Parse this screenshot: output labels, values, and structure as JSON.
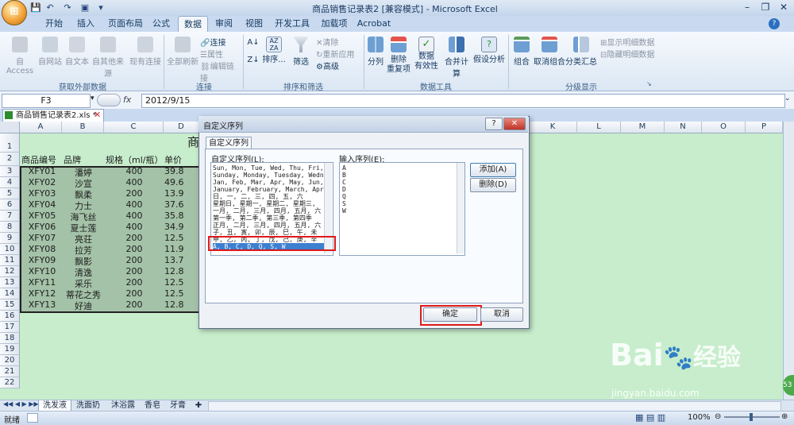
{
  "app": {
    "title": "商品销售记录表2 [兼容模式] - Microsoft Excel",
    "window_buttons": [
      "–",
      "❐",
      "✕"
    ],
    "qat_icons": [
      "save-icon",
      "undo-icon",
      "redo-icon",
      "print-preview-icon"
    ]
  },
  "tabs": [
    "开始",
    "插入",
    "页面布局",
    "公式",
    "数据",
    "审阅",
    "视图",
    "开发工具",
    "加载项",
    "Acrobat"
  ],
  "active_tab": "数据",
  "ribbon": {
    "get_external": {
      "label": "获取外部数据",
      "buttons": [
        "自 Access",
        "自网站",
        "自文本",
        "自其他来源",
        "现有连接"
      ]
    },
    "connections": {
      "label": "连接",
      "refresh": "全部刷新",
      "items": [
        "连接",
        "属性",
        "编辑链接"
      ]
    },
    "sort_filter": {
      "label": "排序和筛选",
      "sort": "排序...",
      "filter": "筛选",
      "items": [
        "清除",
        "重新应用",
        "高级"
      ]
    },
    "data_tools": {
      "label": "数据工具",
      "buttons": [
        "分列",
        "删除\n重复项",
        "数据\n有效性",
        "合并计算",
        "假设分析"
      ]
    },
    "outline": {
      "label": "分级显示",
      "buttons": [
        "组合",
        "取消组合",
        "分类汇总"
      ],
      "items": [
        "显示明细数据",
        "隐藏明细数据"
      ]
    }
  },
  "formula_bar": {
    "cell_ref": "F3",
    "fx": "fx",
    "value": "2012/9/15"
  },
  "workbook_tab": "商品销售记录表2.xls *",
  "columns": [
    "A",
    "B",
    "C",
    "D",
    "K",
    "L",
    "M",
    "N",
    "O",
    "P"
  ],
  "rows": [
    "1",
    "2",
    "3",
    "4",
    "5",
    "6",
    "7",
    "8",
    "9",
    "10",
    "11",
    "12",
    "13",
    "14",
    "15",
    "16",
    "17",
    "18",
    "19",
    "20",
    "21",
    "22"
  ],
  "sheet_title_fragment": "商",
  "headers": [
    "商品编号",
    "品牌",
    "规格（ml/瓶）",
    "单价"
  ],
  "table": [
    [
      "XFY01",
      "潘婷",
      "400",
      "39.8"
    ],
    [
      "XFY02",
      "沙宣",
      "400",
      "49.6"
    ],
    [
      "XFY03",
      "飘柔",
      "200",
      "13.9"
    ],
    [
      "XFY04",
      "力士",
      "400",
      "37.6"
    ],
    [
      "XFY05",
      "海飞丝",
      "400",
      "35.8"
    ],
    [
      "XFY06",
      "夏士莲",
      "400",
      "34.9"
    ],
    [
      "XFY07",
      "亮荘",
      "200",
      "12.5"
    ],
    [
      "XFY08",
      "拉芳",
      "200",
      "11.9"
    ],
    [
      "XFY09",
      "飘影",
      "200",
      "13.7"
    ],
    [
      "XFY10",
      "清逸",
      "200",
      "12.8"
    ],
    [
      "XFY11",
      "采乐",
      "200",
      "12.5"
    ],
    [
      "XFY12",
      "蒂花之秀",
      "200",
      "12.5"
    ],
    [
      "XFY13",
      "好迪",
      "200",
      "12.8"
    ]
  ],
  "dialog": {
    "title": "自定义序列",
    "help": "?",
    "close": "✕",
    "tab": "自定义序列",
    "list_label": "自定义序列(L):",
    "input_label": "输入序列(E):",
    "list_items": [
      "Sun, Mon, Tue, Wed, Thu, Fri, S",
      "Sunday, Monday, Tuesday, Wednes",
      "Jan, Feb, Mar, Apr, May, Jun, J",
      "January, February, March, April",
      "日, 一, 二, 三, 四, 五, 六",
      "星期日, 星期一, 星期二, 星期三,",
      "一月, 二月, 三月, 四月, 五月, 六",
      "第一季, 第二季, 第三季, 第四季",
      "正月, 二月, 三月, 四月, 五月, 六",
      "子, 丑, 寅, 卯, 辰, 巳, 午, 未",
      "甲, 乙, 丙, 丁, 戊, 己, 庚, 辛",
      "A, B, C, D, Q, S, W"
    ],
    "input_items": [
      "A",
      "B",
      "C",
      "D",
      "Q",
      "S",
      "W"
    ],
    "add_button": "添加(A)",
    "delete_button": "删除(D)",
    "ok_button": "确定",
    "cancel_button": "取消"
  },
  "sheet_tabs": [
    "洗发液",
    "洗面奶",
    "沐浴露",
    "香皂",
    "牙膏"
  ],
  "status": {
    "ready": "就绪",
    "zoom": "100%"
  },
  "watermark": {
    "brand": "Bai",
    "brand_cn": "经验",
    "url": "jingyan.baidu.com"
  }
}
